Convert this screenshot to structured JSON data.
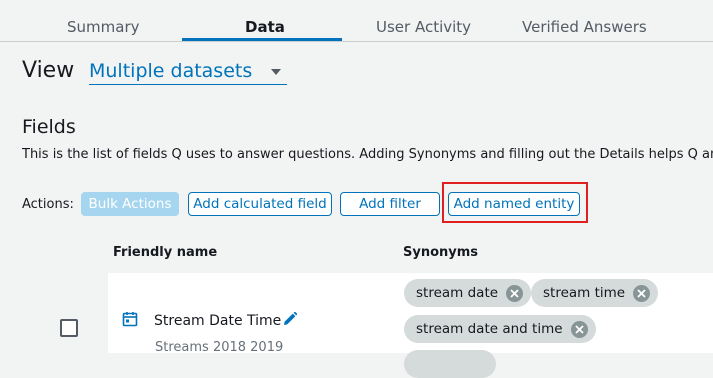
{
  "tabs": [
    {
      "label": "Summary",
      "active": false
    },
    {
      "label": "Data",
      "active": true
    },
    {
      "label": "User Activity",
      "active": false
    },
    {
      "label": "Verified Answers",
      "active": false
    }
  ],
  "view": {
    "label": "View",
    "selected": "Multiple datasets"
  },
  "fields": {
    "title": "Fields",
    "description": "This is the list of fields Q uses to answer questions. Adding Synonyms and filling out the Details helps Q answ"
  },
  "actions": {
    "label": "Actions:",
    "bulk": "Bulk Actions",
    "add_calculated_field": "Add calculated field",
    "add_filter": "Add filter",
    "add_named_entity": "Add named entity"
  },
  "table": {
    "headers": {
      "friendly_name": "Friendly name",
      "synonyms": "Synonyms"
    },
    "rows": [
      {
        "name": "Stream Date Time",
        "source": "Streams 2018 2019",
        "icon": "calendar-icon",
        "synonyms": [
          "stream date",
          "stream time",
          "stream date and time"
        ]
      }
    ]
  },
  "colors": {
    "accent": "#0073bb",
    "disabled_button": "#a6d5ef",
    "chip": "#d5dbdb",
    "highlight": "#e02020"
  }
}
